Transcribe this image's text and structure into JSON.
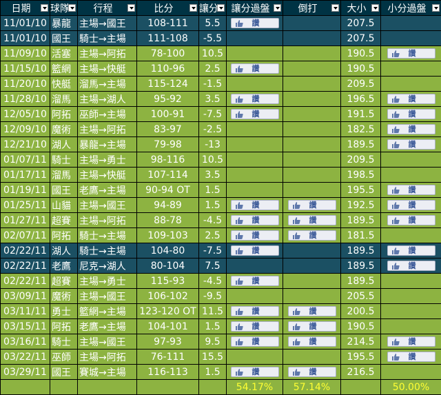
{
  "headers": [
    "日期",
    "球隊",
    "行程",
    "比分",
    "讓分",
    "讓分過盤",
    "倒打",
    "大小",
    "小分過盤"
  ],
  "like_label": "讚",
  "rows": [
    {
      "date": "11/01/10",
      "team": "暴龍",
      "route": "主場→國王",
      "score": "108-111",
      "spread": "5.5",
      "cover": true,
      "reverse": false,
      "ou": "207.5",
      "under": false,
      "shade": "dark"
    },
    {
      "date": "11/01/10",
      "team": "國王",
      "route": "騎士→主場",
      "score": "111-108",
      "spread": "-5.5",
      "cover": false,
      "reverse": false,
      "ou": "207.5",
      "under": false,
      "shade": "dark"
    },
    {
      "date": "11/09/10",
      "team": "活塞",
      "route": "主場→阿拓",
      "score": "78-100",
      "spread": "10.5",
      "cover": false,
      "reverse": false,
      "ou": "190.5",
      "under": true,
      "shade": "light"
    },
    {
      "date": "11/15/10",
      "team": "籃網",
      "route": "主場→快艇",
      "score": "110-96",
      "spread": "2.5",
      "cover": true,
      "reverse": false,
      "ou": "190.5",
      "under": false,
      "shade": "light"
    },
    {
      "date": "11/20/10",
      "team": "快艇",
      "route": "溜馬→主場",
      "score": "115-124",
      "spread": "-1.5",
      "cover": false,
      "reverse": false,
      "ou": "209.5",
      "under": false,
      "shade": "light"
    },
    {
      "date": "11/28/10",
      "team": "溜馬",
      "route": "主場→湖人",
      "score": "95-92",
      "spread": "3.5",
      "cover": true,
      "reverse": false,
      "ou": "196.5",
      "under": true,
      "shade": "light"
    },
    {
      "date": "12/05/10",
      "team": "阿拓",
      "route": "巫師→主場",
      "score": "100-91",
      "spread": "-7.5",
      "cover": true,
      "reverse": false,
      "ou": "191.5",
      "under": true,
      "shade": "light"
    },
    {
      "date": "12/09/10",
      "team": "魔術",
      "route": "主場→阿拓",
      "score": "83-97",
      "spread": "-2.5",
      "cover": false,
      "reverse": false,
      "ou": "182.5",
      "under": true,
      "shade": "light"
    },
    {
      "date": "12/21/10",
      "team": "湖人",
      "route": "暴龍→主場",
      "score": "79-98",
      "spread": "-13",
      "cover": false,
      "reverse": false,
      "ou": "189.5",
      "under": true,
      "shade": "light"
    },
    {
      "date": "01/07/11",
      "team": "騎士",
      "route": "主場→勇士",
      "score": "98-116",
      "spread": "10.5",
      "cover": false,
      "reverse": false,
      "ou": "209.5",
      "under": false,
      "shade": "light"
    },
    {
      "date": "01/17/11",
      "team": "溜馬",
      "route": "主場→快艇",
      "score": "107-114",
      "spread": "3.5",
      "cover": false,
      "reverse": false,
      "ou": "198.5",
      "under": false,
      "shade": "light"
    },
    {
      "date": "01/19/11",
      "team": "國王",
      "route": "老鷹→主場",
      "score": "90-94 OT",
      "spread": "1.5",
      "cover": false,
      "reverse": false,
      "ou": "195.5",
      "under": true,
      "shade": "light"
    },
    {
      "date": "01/25/11",
      "team": "山貓",
      "route": "主場→國王",
      "score": "94-89",
      "spread": "1.5",
      "cover": true,
      "reverse": true,
      "ou": "192.5",
      "under": true,
      "shade": "light"
    },
    {
      "date": "01/27/11",
      "team": "超賽",
      "route": "主場→阿拓",
      "score": "88-78",
      "spread": "-4.5",
      "cover": true,
      "reverse": true,
      "ou": "189.5",
      "under": true,
      "shade": "light"
    },
    {
      "date": "02/07/11",
      "team": "阿拓",
      "route": "騎士→主場",
      "score": "109-103",
      "spread": "2.5",
      "cover": true,
      "reverse": true,
      "ou": "181.5",
      "under": false,
      "shade": "light"
    },
    {
      "date": "02/22/11",
      "team": "湖人",
      "route": "騎士→主場",
      "score": "104-80",
      "spread": "-7.5",
      "cover": true,
      "reverse": false,
      "ou": "189.5",
      "under": true,
      "shade": "dark"
    },
    {
      "date": "02/22/11",
      "team": "老鷹",
      "route": "尼克→湖人",
      "score": "80-104",
      "spread": "7.5",
      "cover": false,
      "reverse": false,
      "ou": "189.5",
      "under": true,
      "shade": "dark"
    },
    {
      "date": "02/22/11",
      "team": "超賽",
      "route": "主場→勇士",
      "score": "115-93",
      "spread": "-4.5",
      "cover": true,
      "reverse": false,
      "ou": "189.5",
      "under": false,
      "shade": "light"
    },
    {
      "date": "03/09/11",
      "team": "魔術",
      "route": "主場→國王",
      "score": "106-102",
      "spread": "-9.5",
      "cover": false,
      "reverse": false,
      "ou": "205.5",
      "under": false,
      "shade": "light"
    },
    {
      "date": "03/11/11",
      "team": "勇士",
      "route": "籃網→主場",
      "score": "123-120 OT",
      "spread": "11.5",
      "cover": true,
      "reverse": true,
      "ou": "200.5",
      "under": false,
      "shade": "light"
    },
    {
      "date": "03/15/11",
      "team": "阿拓",
      "route": "老鷹→主場",
      "score": "104-101",
      "spread": "1.5",
      "cover": true,
      "reverse": true,
      "ou": "190.5",
      "under": false,
      "shade": "light"
    },
    {
      "date": "03/16/11",
      "team": "騎士",
      "route": "主場→國王",
      "score": "97-93",
      "spread": "9.5",
      "cover": true,
      "reverse": true,
      "ou": "214.5",
      "under": true,
      "shade": "light"
    },
    {
      "date": "03/22/11",
      "team": "巫師",
      "route": "主場→阿拓",
      "score": "76-111",
      "spread": "15.5",
      "cover": false,
      "reverse": false,
      "ou": "195.5",
      "under": true,
      "shade": "light"
    },
    {
      "date": "03/29/11",
      "team": "國王",
      "route": "賽城→主場",
      "score": "116-113",
      "spread": "1.5",
      "cover": true,
      "reverse": true,
      "ou": "216.5",
      "under": false,
      "shade": "light"
    }
  ],
  "totals": {
    "cover_pct": "54.17%",
    "reverse_pct": "57.14%",
    "under_pct": "50.00%"
  }
}
